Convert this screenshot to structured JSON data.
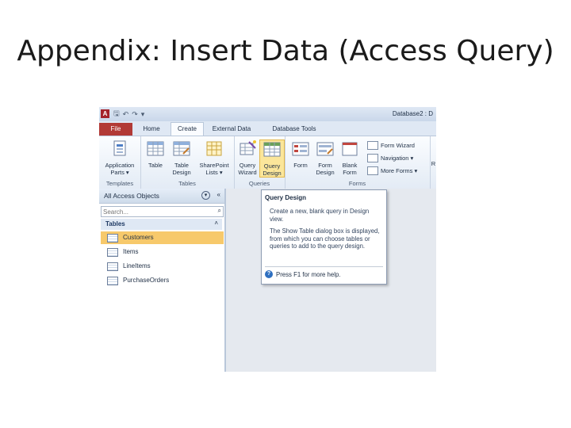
{
  "slide": {
    "title": "Appendix: Insert Data (Access Query)"
  },
  "titlebar": {
    "app_logo": "A",
    "window_title": "Database2 : D"
  },
  "tabs": [
    "File",
    "Home",
    "Create",
    "External Data",
    "Database Tools"
  ],
  "ribbon": {
    "groups": {
      "templates": "Templates",
      "tables": "Tables",
      "queries": "Queries",
      "forms": "Forms"
    },
    "commands": {
      "application_parts": "Application Parts ▾",
      "table": "Table",
      "table_design": "Table Design",
      "sharepoint_lists": "SharePoint Lists ▾",
      "query_wizard": "Query Wizard",
      "query_design": "Query Design",
      "form": "Form",
      "form_design": "Form Design",
      "blank_form": "Blank Form",
      "form_wizard": "Form Wizard",
      "navigation": "Navigation ▾",
      "more_forms": "More Forms ▾",
      "r_cut": "R"
    }
  },
  "nav": {
    "header": "All Access Objects",
    "search_placeholder": "Search...",
    "group": "Tables",
    "items": [
      "Customers",
      "Items",
      "LineItems",
      "PurchaseOrders"
    ]
  },
  "tooltip": {
    "title": "Query Design",
    "line1": "Create a new, blank query in Design view.",
    "line2": "The Show Table dialog box is displayed, from which you can choose tables or queries to add to the query design.",
    "help": "Press F1 for more help."
  },
  "colors": {
    "file_tab": "#b23a36",
    "selected_item": "#f7c96b",
    "highlight_button": "#fbe69a"
  }
}
